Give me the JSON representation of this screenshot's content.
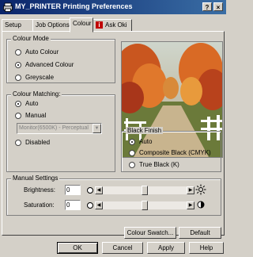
{
  "window": {
    "title": "MY_PRINTER Printing Preferences",
    "help_button": "?",
    "close_button": "×"
  },
  "tabs": [
    {
      "label": "Setup"
    },
    {
      "label": "Job Options"
    },
    {
      "label": "Colour"
    },
    {
      "label": "Ask Oki"
    }
  ],
  "colour_mode": {
    "label": "Colour Mode",
    "options": [
      {
        "label": "Auto Colour",
        "selected": false
      },
      {
        "label": "Advanced Colour",
        "selected": true
      },
      {
        "label": "Greyscale",
        "selected": false
      }
    ]
  },
  "colour_matching": {
    "label": "Colour Matching:",
    "options": [
      {
        "label": "Auto",
        "selected": true
      },
      {
        "label": "Manual",
        "selected": false
      },
      {
        "label": "Disabled",
        "selected": false
      }
    ],
    "profile_value": "Monitor(6500K) - Perceptual"
  },
  "black_finish": {
    "label": "Black Finish",
    "options": [
      {
        "label": "Auto",
        "selected": true
      },
      {
        "label": "Composite Black (CMYK)",
        "selected": false
      },
      {
        "label": "True Black (K)",
        "selected": false
      }
    ]
  },
  "manual_settings": {
    "label": "Manual Settings",
    "brightness": {
      "label": "Brightness:",
      "value": "0",
      "level": 0.5
    },
    "saturation": {
      "label": "Saturation:",
      "value": "0",
      "level": 0.5
    }
  },
  "buttons": {
    "colour_swatch": "Colour Swatch...",
    "default": "Default"
  },
  "footer": {
    "ok": "OK",
    "cancel": "Cancel",
    "apply": "Apply",
    "help": "Help"
  },
  "colors": {
    "title_start": "#0a246a",
    "title_end": "#3a6ea5",
    "dialog_bg": "#d4d0c8"
  }
}
